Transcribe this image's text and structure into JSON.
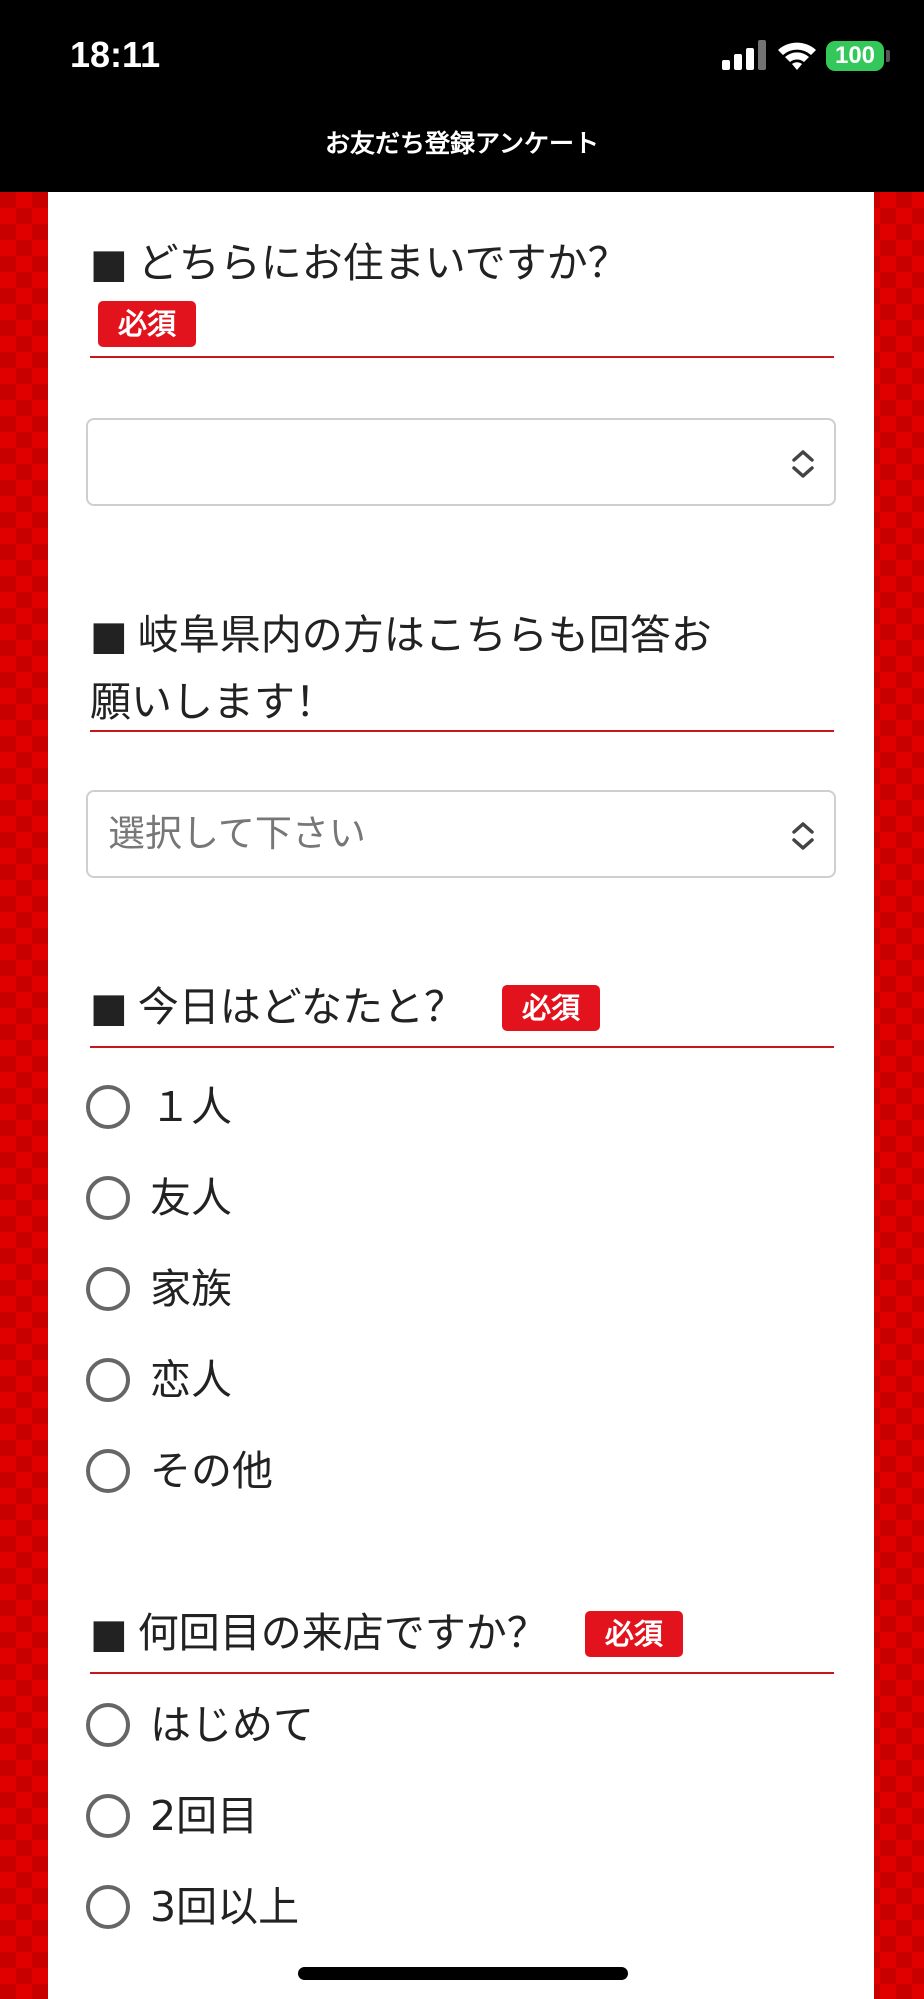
{
  "status_bar": {
    "time": "18:11",
    "battery": "100"
  },
  "nav": {
    "title": "お友だち登録アンケート"
  },
  "required_label": "必須",
  "question_mark": "■",
  "questions": {
    "residence": {
      "title": "どちらにお住まいですか？",
      "selected_value": ""
    },
    "gifu": {
      "title_line1": "岐阜県内の方はこちらも回答お",
      "title_line2": "願いします！",
      "placeholder": "選択して下さい"
    },
    "companion": {
      "title": "今日はどなたと？",
      "options": [
        "１人",
        "友人",
        "家族",
        "恋人",
        "その他"
      ]
    },
    "visits": {
      "title": "何回目の来店ですか？",
      "options": [
        "はじめて",
        "2回目",
        "3回以上"
      ]
    }
  },
  "colors": {
    "accent_red": "#e3131d",
    "rule_red": "#c8161d",
    "battery_green": "#34c759"
  },
  "icons": {
    "select_chevron": "chevron-up-down-icon",
    "radio": "radio-unchecked-icon"
  }
}
